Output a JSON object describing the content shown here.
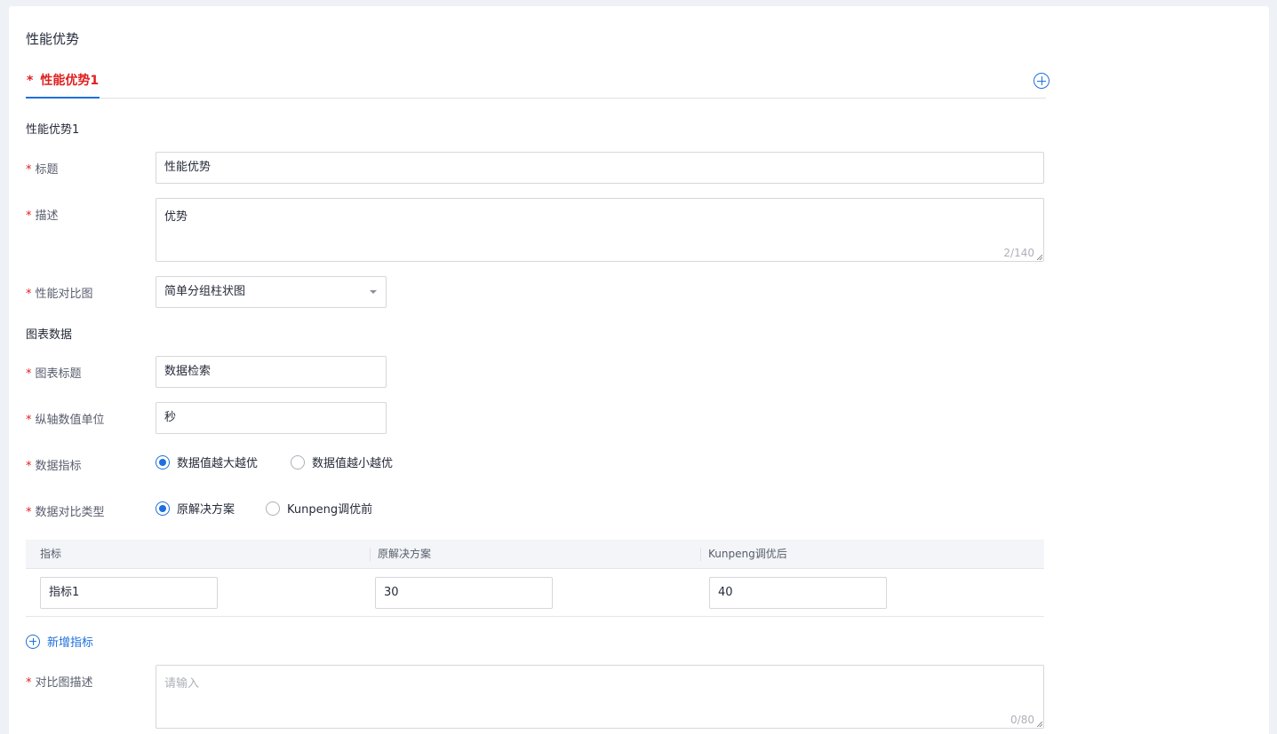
{
  "section": {
    "title": "性能优势"
  },
  "tabs": [
    {
      "label": "性能优势1",
      "required_mark": "*",
      "active": true
    }
  ],
  "form": {
    "group_title": "性能优势1",
    "title": {
      "label": "标题",
      "value": "性能优势"
    },
    "description": {
      "label": "描述",
      "value": "优势",
      "counter": "2/140"
    },
    "chart_type": {
      "label": "性能对比图",
      "value": "简单分组柱状图"
    },
    "chart_group_title": "图表数据",
    "chart_title": {
      "label": "图表标题",
      "value": "数据检索"
    },
    "y_unit": {
      "label": "纵轴数值单位",
      "value": "秒"
    },
    "metric_direction": {
      "label": "数据指标",
      "options": [
        "数据值越大越优",
        "数据值越小越优"
      ],
      "selected": 0
    },
    "compare_type": {
      "label": "数据对比类型",
      "options": [
        "原解决方案",
        "Kunpeng调优前"
      ],
      "selected": 0
    },
    "table": {
      "columns": [
        "指标",
        "原解决方案",
        "Kunpeng调优后"
      ],
      "rows": [
        [
          "指标1",
          "30",
          "40"
        ]
      ]
    },
    "add_metric_label": "新增指标",
    "compare_desc": {
      "label": "对比图描述",
      "placeholder": "请输入",
      "counter": "0/80"
    }
  },
  "colors": {
    "accent": "#1e6fde",
    "required": "#e02020"
  }
}
